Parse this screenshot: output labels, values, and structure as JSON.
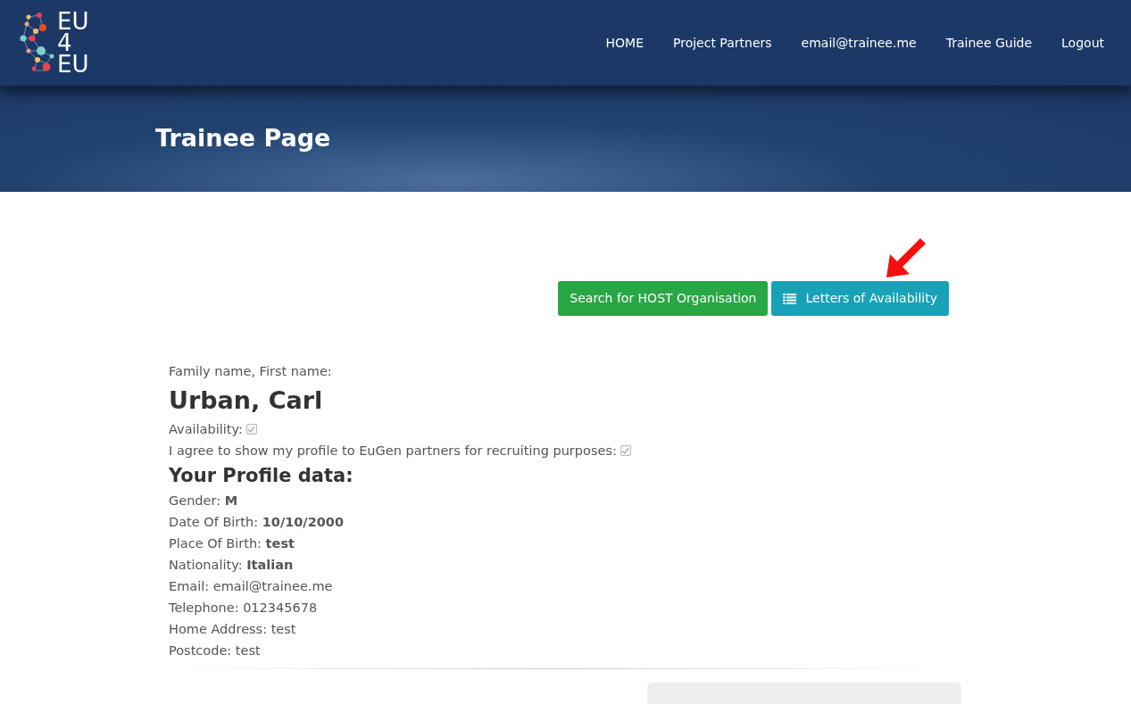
{
  "logo": {
    "lines": [
      "EU",
      "4",
      "EU"
    ]
  },
  "nav": [
    {
      "label": "HOME"
    },
    {
      "label": "Project Partners"
    },
    {
      "label": "email@trainee.me"
    },
    {
      "label": "Trainee Guide"
    },
    {
      "label": "Logout"
    }
  ],
  "banner": {
    "title": "Trainee Page"
  },
  "actions": [
    {
      "label": "Search for HOST Organisation",
      "kind": "success"
    },
    {
      "label": "Letters of Availability",
      "kind": "info"
    }
  ],
  "profile": {
    "name_label": "Family name, First name:",
    "name": "Urban, Carl",
    "flags": [
      {
        "label": "Availability:",
        "checked": true
      },
      {
        "label": "I agree to show my profile to EuGen partners for recruiting purposes:",
        "checked": true
      }
    ],
    "heading": "Your Profile data:",
    "fields": [
      "Gender: **M**",
      "Date Of Birth: **10/10/2000**",
      "Place Of Birth: **test**",
      "Nationality: **Italian**",
      "Email: email@trainee.me",
      "Telephone: 012345678",
      "Home Address: test",
      "Postcode: test"
    ]
  }
}
